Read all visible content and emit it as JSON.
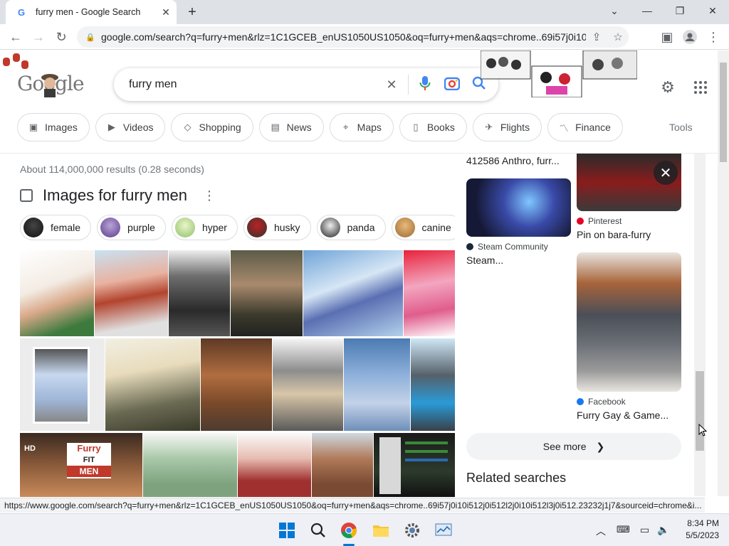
{
  "browser": {
    "tab_title": "furry men - Google Search",
    "url": "google.com/search?q=furry+men&rlz=1C1GCEB_enUS1050US1050&oq=furry+men&aqs=chrome..69i57j0i10i5...",
    "status_url": "https://www.google.com/search?q=furry+men&rlz=1C1GCEB_enUS1050US1050&oq=furry+men&aqs=chrome..69i57j0i10i512j0i512l2j0i10i512l3j0i512.23232j1j7&sourceid=chrome&i..."
  },
  "search": {
    "query": "furry men",
    "logo_text": "Google"
  },
  "chips": [
    {
      "label": "Images",
      "icon": "image-icon"
    },
    {
      "label": "Videos",
      "icon": "play-icon"
    },
    {
      "label": "Shopping",
      "icon": "tag-icon"
    },
    {
      "label": "News",
      "icon": "news-icon"
    },
    {
      "label": "Maps",
      "icon": "pin-icon"
    },
    {
      "label": "Books",
      "icon": "book-icon"
    },
    {
      "label": "Flights",
      "icon": "plane-icon"
    },
    {
      "label": "Finance",
      "icon": "chart-icon"
    }
  ],
  "tools_label": "Tools",
  "results_stats": "About 114,000,000 results (0.28 seconds)",
  "images_heading": "Images for furry men",
  "filters": [
    "female",
    "purple",
    "hyper",
    "husky",
    "panda",
    "canine"
  ],
  "panel": {
    "top_caption": "412586 Anthro, furr...",
    "steam_source": "Steam Community",
    "steam_title": "Steam...",
    "pinterest_source": "Pinterest",
    "pinterest_title": "Pin on bara-furry",
    "facebook_source": "Facebook",
    "facebook_title": "Furry Gay & Game...",
    "see_more": "See more",
    "related": "Related searches"
  },
  "grid_texts": {
    "hd": "HD",
    "furry": "Furry",
    "fit": "FIT",
    "men": "MEN"
  },
  "clock": {
    "time": "8:34 PM",
    "date": "5/5/2023"
  },
  "colors": {
    "accent": "#1a73e8",
    "chip_border": "#dadce0",
    "taskbar": "#eef0f6"
  }
}
